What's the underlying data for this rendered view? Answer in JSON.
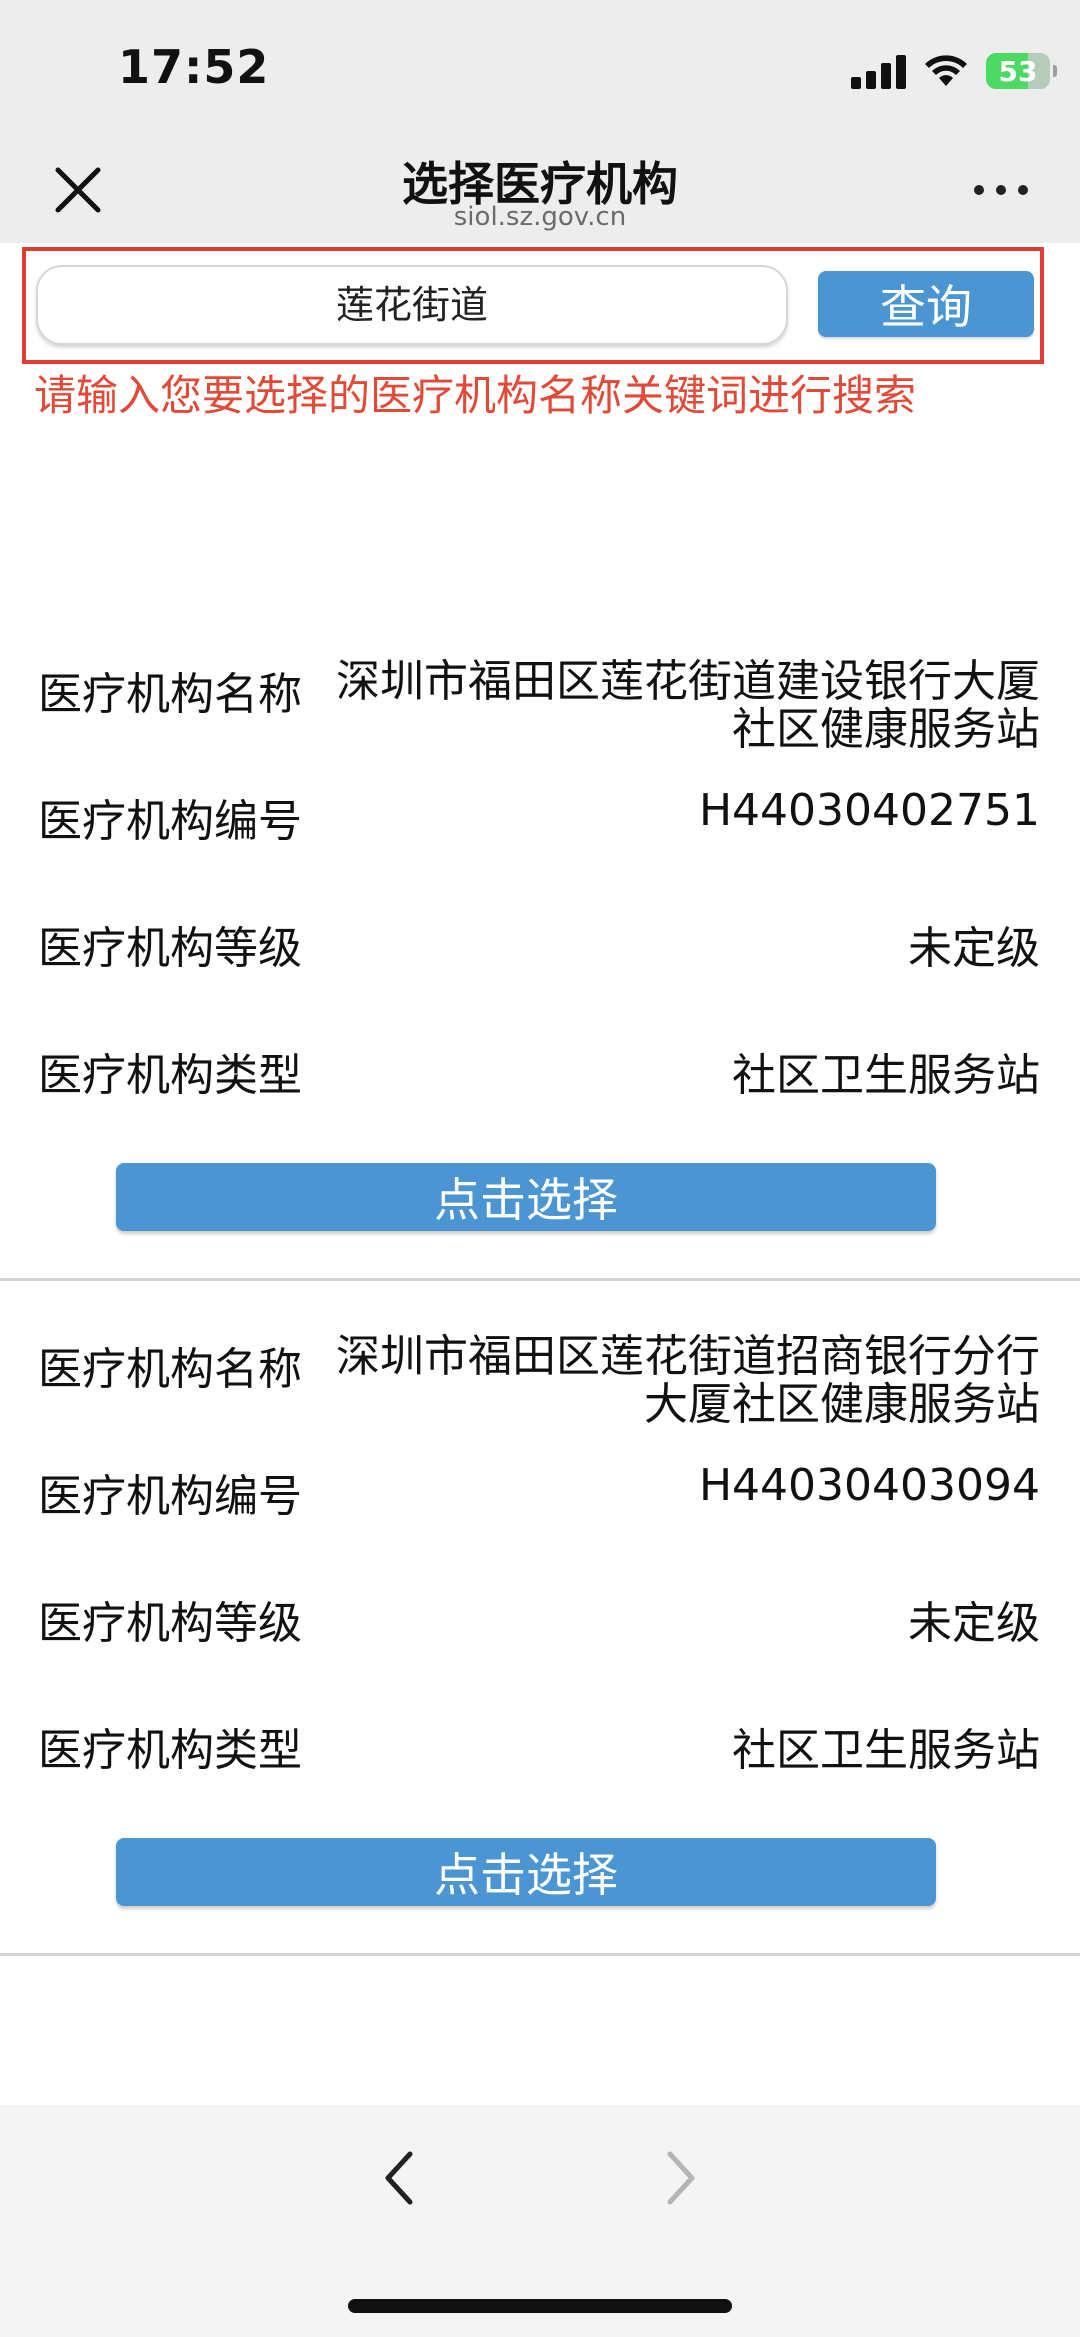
{
  "status_bar": {
    "time": "17:52",
    "battery": "53"
  },
  "nav": {
    "title": "选择医疗机构",
    "subtitle": "siol.sz.gov.cn"
  },
  "search": {
    "value": "莲花街道",
    "button_label": "查询"
  },
  "hint": "请输入您要选择的医疗机构名称关键词进行搜索",
  "results": [
    {
      "name_label": "医疗机构名称",
      "name_value": "深圳市福田区莲花街道建设银行大厦社区健康服务站",
      "code_label": "医疗机构编号",
      "code_value": "H44030402751",
      "level_label": "医疗机构等级",
      "level_value": "未定级",
      "type_label": "医疗机构类型",
      "type_value": "社区卫生服务站",
      "select_label": "点击选择"
    },
    {
      "name_label": "医疗机构名称",
      "name_value": "深圳市福田区莲花街道招商银行分行大厦社区健康服务站",
      "code_label": "医疗机构编号",
      "code_value": "H44030403094",
      "level_label": "医疗机构等级",
      "level_value": "未定级",
      "type_label": "医疗机构类型",
      "type_value": "社区卫生服务站",
      "select_label": "点击选择"
    }
  ],
  "colors": {
    "accent": "#4a95d2",
    "hint": "#e04a36",
    "highlight_border": "#e03c31"
  }
}
